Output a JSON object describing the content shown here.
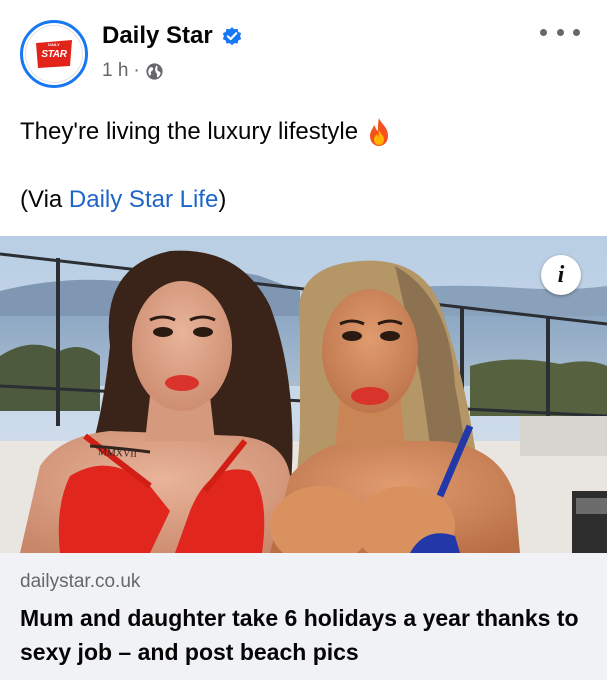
{
  "post": {
    "author": "Daily Star",
    "avatar_logo_text": "STAR",
    "avatar_logo_small": "DAILY",
    "time": "1 h",
    "separator": "·",
    "icons": {
      "verified": "verified-badge-icon",
      "audience": "globe-icon",
      "more": "more-options-icon",
      "emoji": "fire-emoji-icon",
      "info": "info-icon"
    },
    "text_line1": "They're living the luxury lifestyle",
    "text_line2_prefix": "(Via ",
    "text_line2_link": "Daily Star Life",
    "text_line2_suffix": ")"
  },
  "image": {
    "tattoo_text": "MMXVII",
    "info_label": "i"
  },
  "link_preview": {
    "domain": "dailystar.co.uk",
    "headline": "Mum and daughter take 6 holidays a year thanks to sexy job – and post beach pics"
  },
  "colors": {
    "brand_blue": "#1877f2",
    "link_blue": "#1f65c7",
    "logo_red": "#e2231a",
    "secondary_text": "#65676b",
    "preview_bg": "#f0f2f5"
  }
}
